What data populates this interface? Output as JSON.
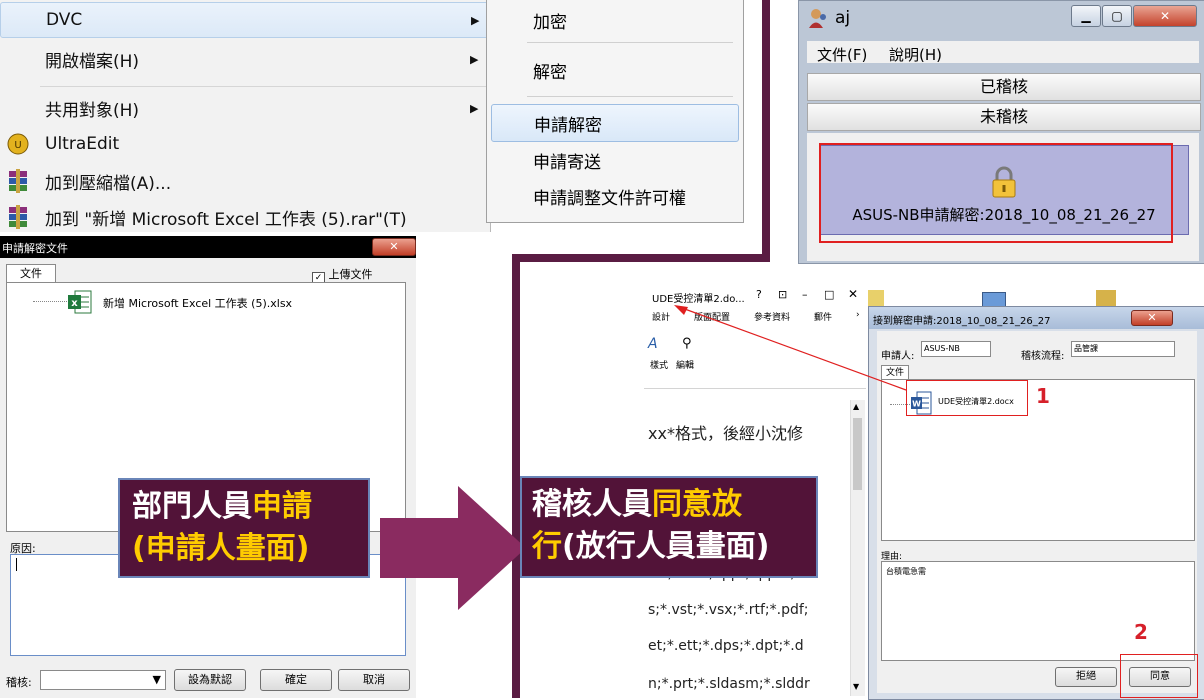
{
  "context_menu": {
    "items": [
      {
        "label": "DVC",
        "submenu": true
      },
      {
        "label": "開啟檔案(H)",
        "submenu": true
      },
      {
        "label": "共用對象(H)",
        "submenu": true
      },
      {
        "label": "UltraEdit",
        "icon": "ultraedit-icon"
      },
      {
        "label": "加到壓縮檔(A)...",
        "icon": "winrar-icon"
      },
      {
        "label": "加到 \"新增 Microsoft Excel 工作表 (5).rar\"(T)",
        "icon": "winrar-icon"
      }
    ],
    "submenu": [
      {
        "label": "加密"
      },
      {
        "label": "解密"
      },
      {
        "label": "申請解密"
      },
      {
        "label": "申請寄送"
      },
      {
        "label": "申請調整文件許可權"
      }
    ]
  },
  "aj_window": {
    "title": "aj",
    "menu": [
      "文件(F)",
      "說明(H)"
    ],
    "buttons": [
      "已稽核",
      "未稽核"
    ],
    "item_caption": "ASUS-NB申請解密:2018_10_08_21_26_27"
  },
  "apply_dialog": {
    "title": "申請解密文件",
    "tab": "文件",
    "upload_checkbox": "上傳文件",
    "file_name": "新增 Microsoft Excel 工作表 (5).xlsx",
    "reason_label": "原因:",
    "auditor_label": "稽核:",
    "set_default_button": "設為默認",
    "ok_button": "確定",
    "cancel_button": "取消"
  },
  "callouts": {
    "left_line1_white": "部門人員",
    "left_line1_yellow": "申請",
    "left_line2": "(申請人畫面)",
    "right_line1_white": "稽核人員",
    "right_line1_yellow": "同意放",
    "right_line2_yellow": "行",
    "right_line2_white": "(放行人員畫面)"
  },
  "word_doc": {
    "title": "UDE受控清單2.do...",
    "tabs": [
      "設計",
      "版面配置",
      "參考資料",
      "郵件"
    ],
    "groups": [
      "樣式",
      "編輯"
    ],
    "lines": [
      "xx*格式，後經小沈修",
      "xls, .xlsx, .ppt, .pptx,*",
      "s;*.vst;*.vsx;*.rtf;*.pdf;",
      "et;*.ett;*.dps;*.dpt;*.d",
      "n;*.prt;*.sldasm;*.slddr"
    ]
  },
  "approve_dialog": {
    "title": "接到解密申請:2018_10_08_21_26_27",
    "applicant_label": "申請人:",
    "applicant_value": "ASUS-NB",
    "flow_label": "稽核流程:",
    "flow_value": "品管課",
    "tab": "文件",
    "file_name": "UDE受控清單2.docx",
    "reason_label": "理由:",
    "reason_value": "台積電急需",
    "reject_button": "拒絕",
    "agree_button": "同意",
    "step1": "1",
    "step2": "2"
  }
}
